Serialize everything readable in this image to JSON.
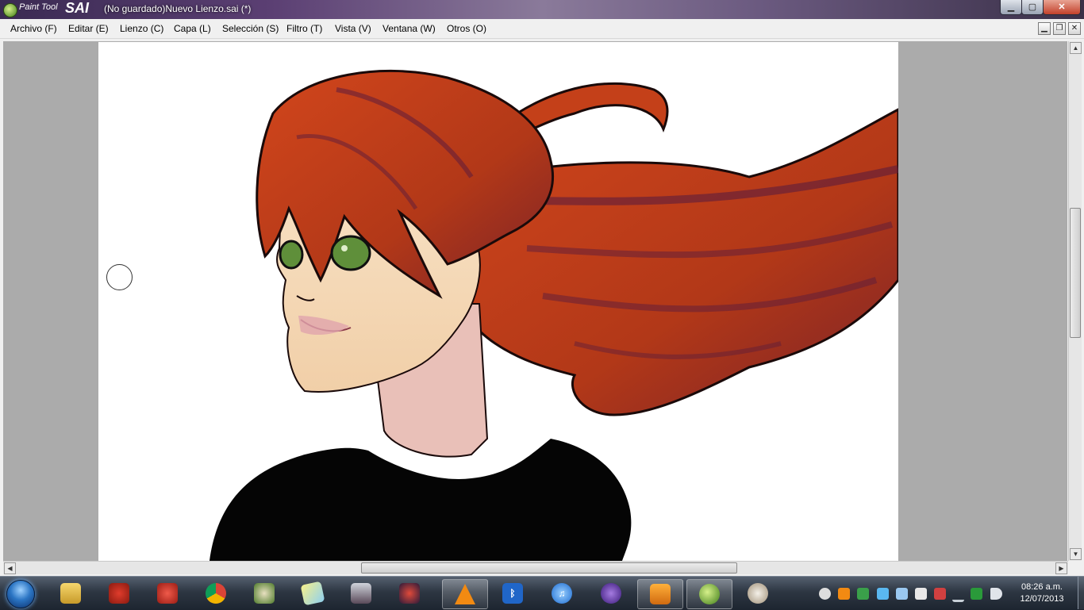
{
  "window": {
    "app_name_small": "Paint Tool",
    "app_name_large": "SAI",
    "title": "(No guardado)Nuevo Lienzo.sai (*)",
    "buttons": {
      "minimize": "▁",
      "maximize": "▢",
      "close": "✕"
    }
  },
  "menu": [
    "Archivo (F)",
    "Editar (E)",
    "Lienzo (C)",
    "Capa (L)",
    "Selección (S)",
    "Filtro (T)",
    "Vista (V)",
    "Ventana (W)",
    "Otros (O)"
  ],
  "mdi_buttons": {
    "minimize": "▁",
    "restore": "❐",
    "close": "✕"
  },
  "scroll": {
    "vertical_position": 0.32,
    "horizontal_position": 0.34
  },
  "taskbar": {
    "apps": [
      "windows-explorer",
      "angry-birds",
      "angry-birds-seasons",
      "google-chrome",
      "plants-vs-zombies",
      "sticky-notes",
      "devil-may-cry",
      "angry-birds-space",
      "vlc-media-player",
      "bluetooth",
      "itunes",
      "bittorrent",
      "windows-media-player",
      "paint-tool-sai",
      "paint"
    ],
    "active_app": "paint-tool-sai"
  },
  "clock": {
    "time": "08:26 a.m.",
    "date": "12/07/2013"
  },
  "colors": {
    "hair": "#b83a18",
    "hair_shadow": "#5c1c3c",
    "skin": "#f5d9b8",
    "skin_shadow": "#d88aa0",
    "eyes": "#5f8f3a",
    "shirt": "#050505",
    "workspace": "#ababab"
  }
}
